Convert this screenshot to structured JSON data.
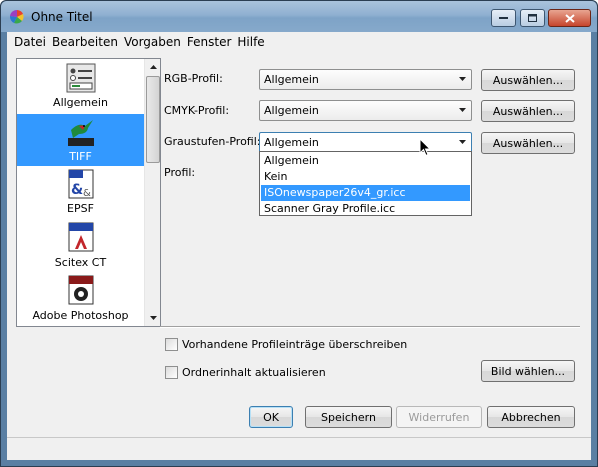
{
  "window": {
    "title": "Ohne Titel"
  },
  "menu": [
    "Datei",
    "Bearbeiten",
    "Vorgaben",
    "Fenster",
    "Hilfe"
  ],
  "sidebar": {
    "items": [
      {
        "label": "Allgemein",
        "icon": "general-settings-icon"
      },
      {
        "label": "TIFF",
        "icon": "tiff-hummingbird-icon",
        "selected": true
      },
      {
        "label": "EPSF",
        "icon": "epsf-icon"
      },
      {
        "label": "Scitex CT",
        "icon": "scitex-icon"
      },
      {
        "label": "Adobe Photoshop",
        "icon": "photoshop-photo-icon"
      }
    ]
  },
  "profiles": {
    "rgb": {
      "label": "RGB-Profil:",
      "value": "Allgemein",
      "button": "Auswählen..."
    },
    "cmyk": {
      "label": "CMYK-Profil:",
      "value": "Allgemein",
      "button": "Auswählen..."
    },
    "gray": {
      "label": "Graustufen-Profil:",
      "value": "Allgemein",
      "button": "Auswählen..."
    },
    "profile_label": "Profil:"
  },
  "dropdown": {
    "options": [
      "Allgemein",
      "Kein",
      "ISOnewspaper26v4_gr.icc",
      "Scanner Gray Profile.icc"
    ],
    "highlighted": "ISOnewspaper26v4_gr.icc"
  },
  "options": {
    "overwrite": {
      "label": "Vorhandene Profileinträge überschreiben",
      "checked": false
    },
    "refresh": {
      "label": "Ordnerinhalt aktualisieren",
      "checked": false
    },
    "choose_image": "Bild wählen..."
  },
  "footer": {
    "ok": "OK",
    "save": "Speichern",
    "revert": "Widerrufen",
    "cancel": "Abbrechen"
  },
  "colors": {
    "selection": "#3399ff",
    "titlebar": "#8fb0d1",
    "dialog": "#f0f0f0"
  }
}
